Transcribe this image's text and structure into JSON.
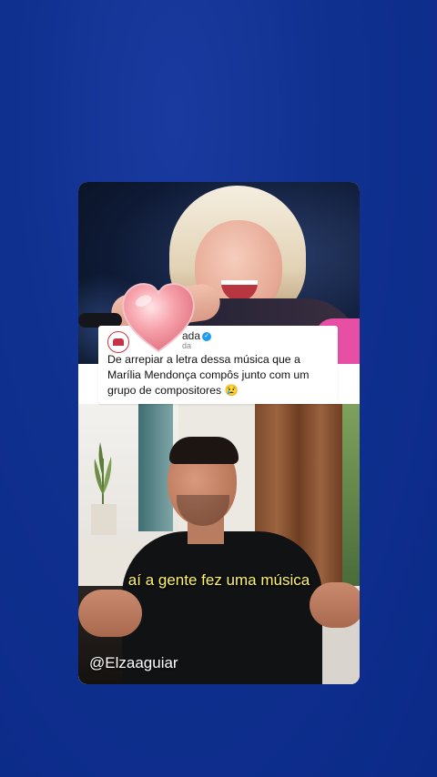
{
  "tweet": {
    "account_name": "ada",
    "account_handle": "da",
    "text": "De arrepiar a letra dessa música que a Marília Mendonça compôs junto com um grupo de compositores 😢"
  },
  "video": {
    "caption": "aí a gente fez uma música",
    "watermark": "@Elzaaguiar"
  },
  "sticker": {
    "icon": "heart-icon",
    "color": "#f48a96"
  },
  "colors": {
    "background": "#10308f",
    "caption": "#fff46a",
    "verified": "#1d9bf0"
  }
}
